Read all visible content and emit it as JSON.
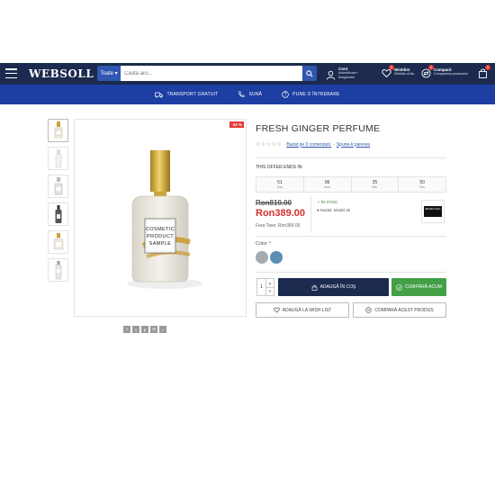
{
  "header": {
    "logo": "WEBSOLL",
    "search": {
      "category": "Toate",
      "placeholder": "Caută aici..."
    },
    "account": {
      "title": "Cont",
      "subtitle1": "Autentificare /",
      "subtitle2": "Înregistrare"
    },
    "wishlist": {
      "title": "Wishlist",
      "subtitle": "Wishlist-ul tău",
      "count": "0"
    },
    "compare": {
      "title": "Compară",
      "subtitle": "Compararea produselor",
      "count": "0"
    },
    "cart": {
      "count": "0"
    }
  },
  "subnav": {
    "items": [
      {
        "label": "TRANSPORT GRATUIT",
        "icon": "truck-icon"
      },
      {
        "label": "SUNĂ",
        "icon": "phone-icon"
      },
      {
        "label": "PUNE O ÎNTREBARE",
        "icon": "question-icon"
      }
    ]
  },
  "gallery": {
    "discount": "-32 %",
    "main_image_text": [
      "COSMETIC",
      "PRODUCT",
      "SAMPLE"
    ],
    "share_icons": [
      "f",
      "t",
      "p",
      "✉",
      "+"
    ]
  },
  "product": {
    "title": "FRESH GINGER PERFUME",
    "rating": {
      "stars": "☆☆☆☆☆",
      "reviews_link": "Bazat pe 0 comentarii.",
      "separator": "-",
      "write_review": "Spune-ti parerea"
    },
    "offer_label": "THIS OFFER ENDS IN:",
    "countdown": [
      {
        "value": "51",
        "unit": "Day"
      },
      {
        "value": "06",
        "unit": "Hour"
      },
      {
        "value": "25",
        "unit": "Min"
      },
      {
        "value": "50",
        "unit": "Sec"
      }
    ],
    "old_price": "Ron810.00",
    "new_price": "Ron389.00",
    "tax": "Fara Taxe: Ron389.00",
    "stock": "✓ ÎN STOC",
    "model": "● Model: Model 4£",
    "brand_logo_text": "BRAND LOGO",
    "color_label": "Color",
    "color_required": "*",
    "colors": [
      "#a7abb0",
      "#5b8fb5"
    ],
    "quantity": "1",
    "add_to_cart": "ADAUGĂ ÎN COŞ",
    "buy_now": "CUMPĂRĂ ACUM",
    "add_wishlist": "ADAUGĂ LA WISH LIST",
    "compare": "COMPARĂ ACEST PRODUS"
  },
  "colors": {
    "header_bg": "#1b2a4e",
    "subnav_bg": "#1d3ea3",
    "price_red": "#d32f2f",
    "buy_green": "#43a047"
  }
}
